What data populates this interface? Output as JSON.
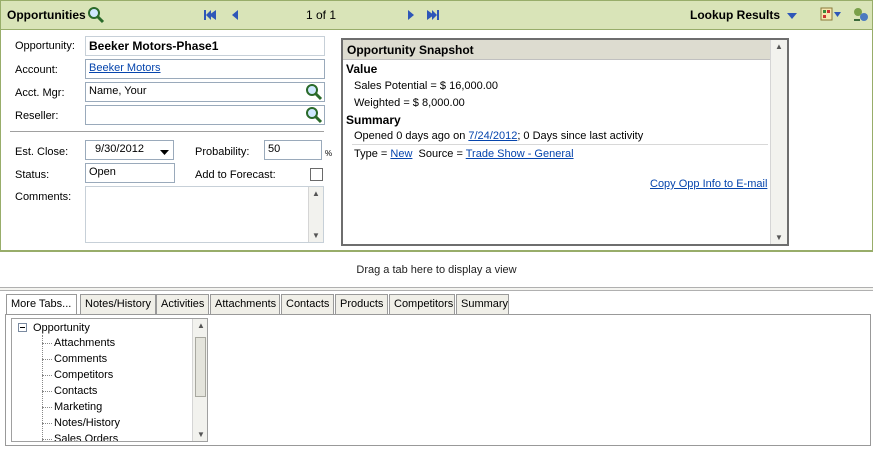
{
  "header": {
    "title": "Opportunities",
    "pager": "1 of 1",
    "lookup_label": "Lookup Results"
  },
  "form": {
    "opportunity_label": "Opportunity:",
    "opportunity_value": "Beeker Motors-Phase1",
    "account_label": "Account:",
    "account_value": "Beeker Motors",
    "acct_mgr_label": "Acct. Mgr:",
    "acct_mgr_value": "Name, Your",
    "reseller_label": "Reseller:",
    "reseller_value": "",
    "est_close_label": "Est. Close:",
    "est_close_value": "9/30/2012",
    "probability_label": "Probability:",
    "probability_value": "50",
    "probability_unit": "%",
    "status_label": "Status:",
    "status_value": "Open",
    "forecast_label": "Add to Forecast:",
    "comments_label": "Comments:",
    "comments_value": ""
  },
  "snapshot": {
    "title": "Opportunity Snapshot",
    "value_heading": "Value",
    "sales_potential": "Sales Potential = $ 16,000.00",
    "weighted": "Weighted = $ 8,000.00",
    "summary_heading": "Summary",
    "opened_prefix": "Opened 0 days ago on ",
    "opened_date": "7/24/2012",
    "opened_suffix": "; 0 Days since last activity",
    "type_prefix": "Type = ",
    "type_value": "New",
    "source_prefix": "Source = ",
    "source_value": "Trade Show - General",
    "copy_link": "Copy Opp Info to E-mail"
  },
  "drag_hint": "Drag a tab here to display a view",
  "tabs": [
    "More Tabs...",
    "Notes/History",
    "Activities",
    "Attachments",
    "Contacts",
    "Products",
    "Competitors",
    "Summary"
  ],
  "tree": {
    "root": "Opportunity",
    "items": [
      "Attachments",
      "Comments",
      "Competitors",
      "Contacts",
      "Marketing",
      "Notes/History",
      "Sales Orders"
    ]
  }
}
